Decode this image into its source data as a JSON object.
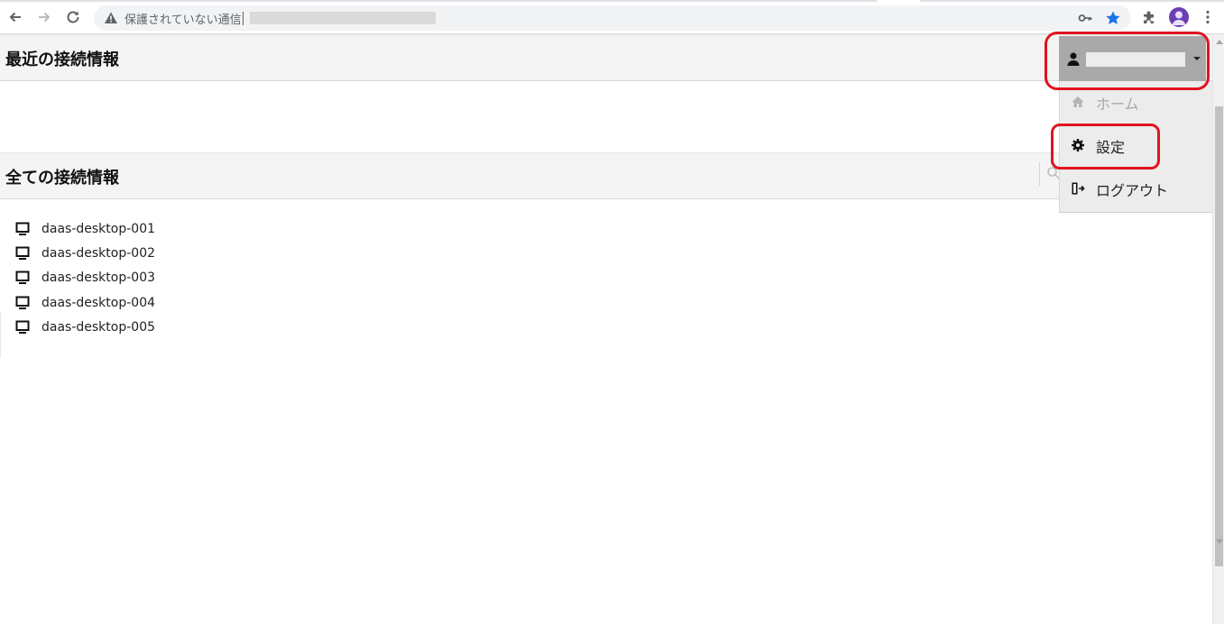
{
  "browser": {
    "back_icon": "arrow-left-icon",
    "forward_icon": "arrow-right-icon",
    "reload_icon": "reload-icon",
    "security_warning": "保護されていない通信",
    "address_value": "",
    "toolbar_icons": [
      "key-icon",
      "bookmark-star-icon",
      "extensions-icon",
      "profile-avatar-icon",
      "menu-kebab-icon"
    ],
    "star_color": "#1a73e8"
  },
  "page": {
    "recent_section_title": "最近の接続情報",
    "all_section_title": "全ての接続情報",
    "connections": [
      {
        "name": "daas-desktop-001",
        "icon": "monitor-icon"
      },
      {
        "name": "daas-desktop-002",
        "icon": "monitor-icon"
      },
      {
        "name": "daas-desktop-003",
        "icon": "monitor-icon"
      },
      {
        "name": "daas-desktop-004",
        "icon": "monitor-icon"
      },
      {
        "name": "daas-desktop-005",
        "icon": "monitor-icon"
      }
    ]
  },
  "user_menu": {
    "username": "",
    "items": [
      {
        "label": "ホーム",
        "icon": "home-icon",
        "enabled": false
      },
      {
        "label": "設定",
        "icon": "gear-icon",
        "enabled": true
      },
      {
        "label": "ログアウト",
        "icon": "logout-icon",
        "enabled": true
      }
    ]
  },
  "annotations": {
    "highlight_color": "#e0141e"
  }
}
